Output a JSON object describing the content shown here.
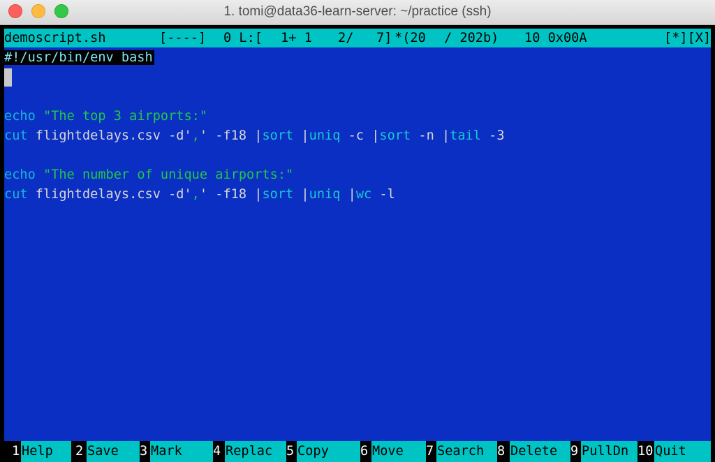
{
  "window": {
    "title": "1. tomi@data36-learn-server: ~/practice (ssh)"
  },
  "status_bar": {
    "filename": "demoscript.sh",
    "flags": "[----]",
    "column": "0 L:[",
    "line_info": "1+ 1",
    "line_of": "2/",
    "total_lines": "7]",
    "offset": "*(20",
    "size": "/ 202b)",
    "char_code": "10 0x00A",
    "window_buttons": "[*][X]"
  },
  "editor": {
    "lines": [
      {
        "type": "shebang",
        "text": "#!/usr/bin/env bash"
      },
      {
        "type": "cursor",
        "text": ""
      },
      {
        "type": "blank",
        "text": ""
      },
      {
        "type": "code",
        "tokens": [
          {
            "cls": "kw",
            "text": "echo "
          },
          {
            "cls": "str",
            "text": "\"The top 3 airports:\""
          }
        ]
      },
      {
        "type": "code",
        "tokens": [
          {
            "cls": "kw",
            "text": "cut "
          },
          {
            "cls": "plain",
            "text": "flightdelays.csv -d'"
          },
          {
            "cls": "str",
            "text": ","
          },
          {
            "cls": "plain",
            "text": "' -f18 |"
          },
          {
            "cls": "cmd",
            "text": "sort "
          },
          {
            "cls": "plain",
            "text": "|"
          },
          {
            "cls": "cmd",
            "text": "uniq "
          },
          {
            "cls": "plain",
            "text": "-c |"
          },
          {
            "cls": "cmd",
            "text": "sort "
          },
          {
            "cls": "plain",
            "text": "-n |"
          },
          {
            "cls": "cmd",
            "text": "tail "
          },
          {
            "cls": "plain",
            "text": "-3"
          }
        ]
      },
      {
        "type": "blank",
        "text": ""
      },
      {
        "type": "code",
        "tokens": [
          {
            "cls": "kw",
            "text": "echo "
          },
          {
            "cls": "str",
            "text": "\"The number of unique airports:\""
          }
        ]
      },
      {
        "type": "code",
        "tokens": [
          {
            "cls": "kw",
            "text": "cut "
          },
          {
            "cls": "plain",
            "text": "flightdelays.csv -d'"
          },
          {
            "cls": "str",
            "text": ","
          },
          {
            "cls": "plain",
            "text": "' -f18 |"
          },
          {
            "cls": "cmd",
            "text": "sort "
          },
          {
            "cls": "plain",
            "text": "|"
          },
          {
            "cls": "cmd",
            "text": "uniq "
          },
          {
            "cls": "plain",
            "text": "|"
          },
          {
            "cls": "cmd",
            "text": "wc "
          },
          {
            "cls": "plain",
            "text": "-l"
          }
        ]
      }
    ]
  },
  "function_keys": [
    {
      "num": "1",
      "label": "Help"
    },
    {
      "num": "2",
      "label": "Save"
    },
    {
      "num": "3",
      "label": "Mark"
    },
    {
      "num": "4",
      "label": "Replac"
    },
    {
      "num": "5",
      "label": "Copy"
    },
    {
      "num": "6",
      "label": "Move"
    },
    {
      "num": "7",
      "label": "Search"
    },
    {
      "num": "8",
      "label": "Delete"
    },
    {
      "num": "9",
      "label": "PullDn"
    },
    {
      "num": "10",
      "label": "Quit"
    }
  ],
  "colors": {
    "editor_bg": "#0a2fc2",
    "status_bg": "#00c4c4",
    "keyword": "#19b6d8",
    "string": "#22c84a"
  }
}
